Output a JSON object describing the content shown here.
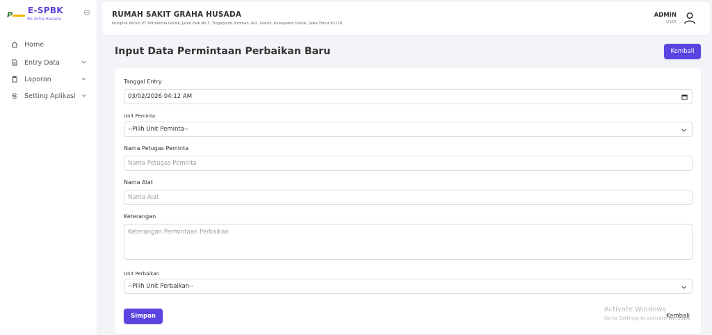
{
  "brand": {
    "title": "E-SPBK",
    "subtitle": "RS Grha Husada"
  },
  "sidebar": {
    "items": [
      {
        "label": "Home",
        "icon": "home-icon"
      },
      {
        "label": "Entry Data",
        "icon": "document-icon"
      },
      {
        "label": "Laporan",
        "icon": "clipboard-icon"
      },
      {
        "label": "Setting Aplikasi",
        "icon": "gear-icon"
      }
    ]
  },
  "header": {
    "hospital_name": "RUMAH SAKIT GRAHA HUSADA",
    "address": "Komplek Perum PT Petrokimia Gresik, Jalan Padi No.3, Tlogopojok, Kroman, Kec. Gresik, Kabupaten Gresik, Jawa Timur 61118",
    "user_name": "ADMIN",
    "user_role": "USER"
  },
  "page": {
    "title": "Input Data Permintaan Perbaikan Baru",
    "back_button": "Kembali"
  },
  "form": {
    "tanggal_entry": {
      "label": "Tanggal Entry",
      "value": "03/02/2026 04:12 AM"
    },
    "unit_peminta": {
      "label": "Unit Peminta",
      "value": "--Pilih Unit Peminta--"
    },
    "nama_petugas": {
      "label": "Nama Petugas Peminta",
      "placeholder": "Nama Petugas Peminta"
    },
    "nama_alat": {
      "label": "Nama Alat",
      "placeholder": "Nama Alat"
    },
    "keterangan": {
      "label": "Keterangan",
      "placeholder": "Keterangan Permintaan Perbaikan"
    },
    "unit_perbaikan": {
      "label": "Unit Perbaikan",
      "value": "--Pilih Unit Perbaikan--"
    },
    "save_button": "Simpan",
    "back_link": "Kembali"
  },
  "watermark": {
    "line1": "Activate Windows",
    "line2": "Go to Settings to activate Windows."
  },
  "colors": {
    "accent": "#5a44e0",
    "brand": "#5b3fd9"
  }
}
